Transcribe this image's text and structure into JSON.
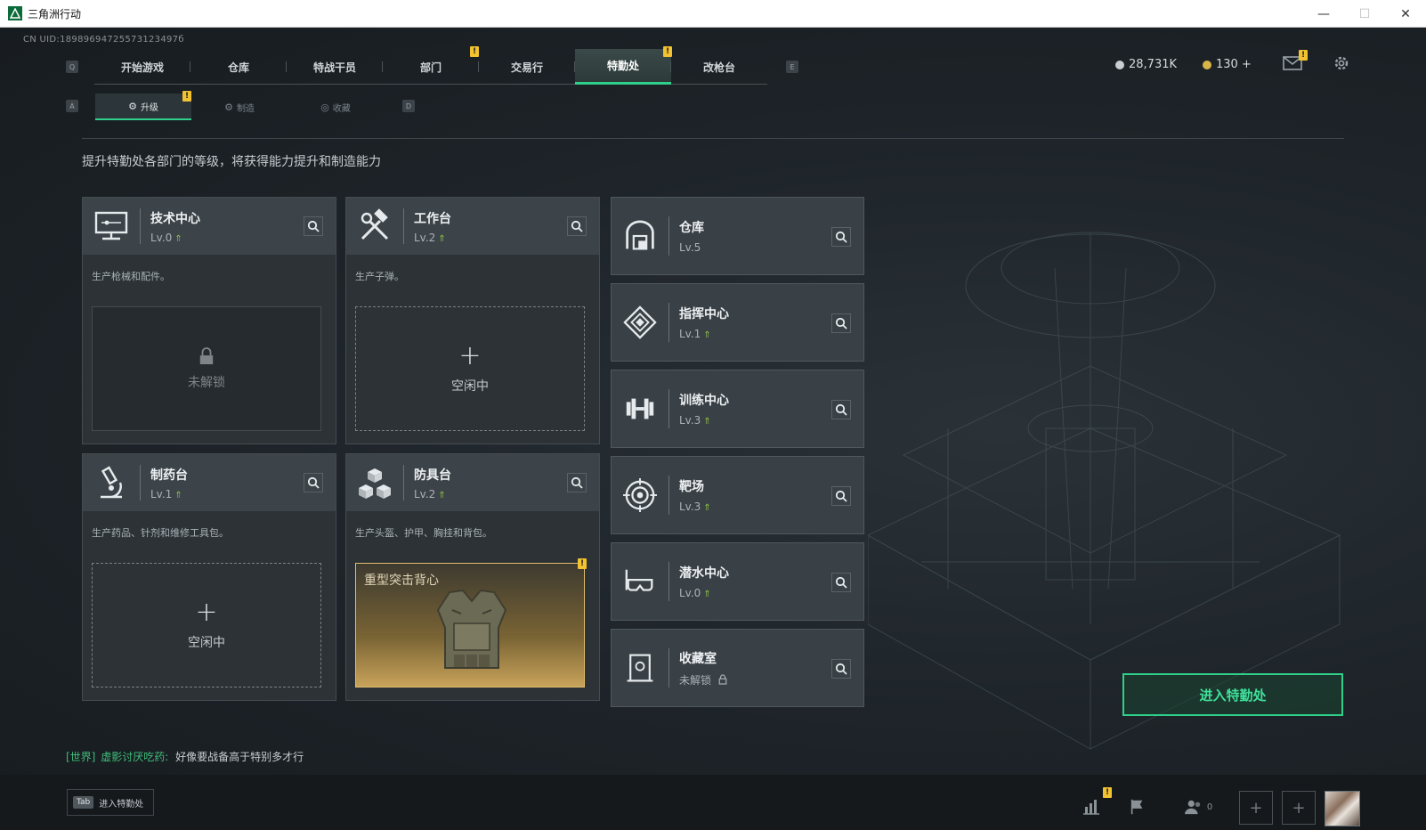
{
  "window": {
    "title": "三角洲行动",
    "minimize": "—",
    "maximize": "☐",
    "close": "✕"
  },
  "uid": "CN UID:18989694725573123497б",
  "keyhints": {
    "q": "Q",
    "e": "E",
    "a": "A",
    "d": "D"
  },
  "topnav": {
    "tabs": [
      {
        "label": "开始游戏"
      },
      {
        "label": "仓库"
      },
      {
        "label": "特战干员"
      },
      {
        "label": "部门"
      },
      {
        "label": "交易行"
      },
      {
        "label": "特勤处"
      },
      {
        "label": "改枪台"
      }
    ],
    "active_index": 5
  },
  "badge_text": "!",
  "currency": {
    "money": "28,731K",
    "coupons": "130 +"
  },
  "subnav": {
    "tabs": [
      {
        "label": "升级"
      },
      {
        "label": "制造"
      },
      {
        "label": "收藏"
      }
    ]
  },
  "description": "提升特勤处各部门的等级，将获得能力提升和制造能力",
  "cards": {
    "tech": {
      "name": "技术中心",
      "level": "Lv.0",
      "desc": "生产枪械和配件。",
      "slot_label": "未解锁"
    },
    "workbench": {
      "name": "工作台",
      "level": "Lv.2",
      "desc": "生产子弹。",
      "slot_label": "空闲中",
      "plus": "+"
    },
    "pharmacy": {
      "name": "制药台",
      "level": "Lv.1",
      "desc": "生产药品、针剂和维修工具包。",
      "slot_label": "空闲中",
      "plus": "+"
    },
    "armor": {
      "name": "防具台",
      "level": "Lv.2",
      "desc": "生产头盔、护甲、胸挂和背包。",
      "item_name": "重型突击背心"
    }
  },
  "right_cards": [
    {
      "name": "仓库",
      "level": "Lv.5"
    },
    {
      "name": "指挥中心",
      "level": "Lv.1"
    },
    {
      "name": "训练中心",
      "level": "Lv.3"
    },
    {
      "name": "靶场",
      "level": "Lv.3"
    },
    {
      "name": "潜水中心",
      "level": "Lv.0"
    },
    {
      "name": "收藏室",
      "level": "未解锁"
    }
  ],
  "upgrade_arrow": "⇑",
  "enter_button": "进入特勤处",
  "chat": {
    "channel": "[世界]",
    "user": "虚影讨厌吃药:",
    "message": "好像要战备高于特别多才行"
  },
  "bottom": {
    "tab_key": "Tab",
    "tab_label": "进入特勤处",
    "friends_count": "0",
    "plus": "+"
  },
  "colors": {
    "accent": "#2fd08a",
    "badge": "#f2c230",
    "upgrade": "#8fc34a"
  }
}
